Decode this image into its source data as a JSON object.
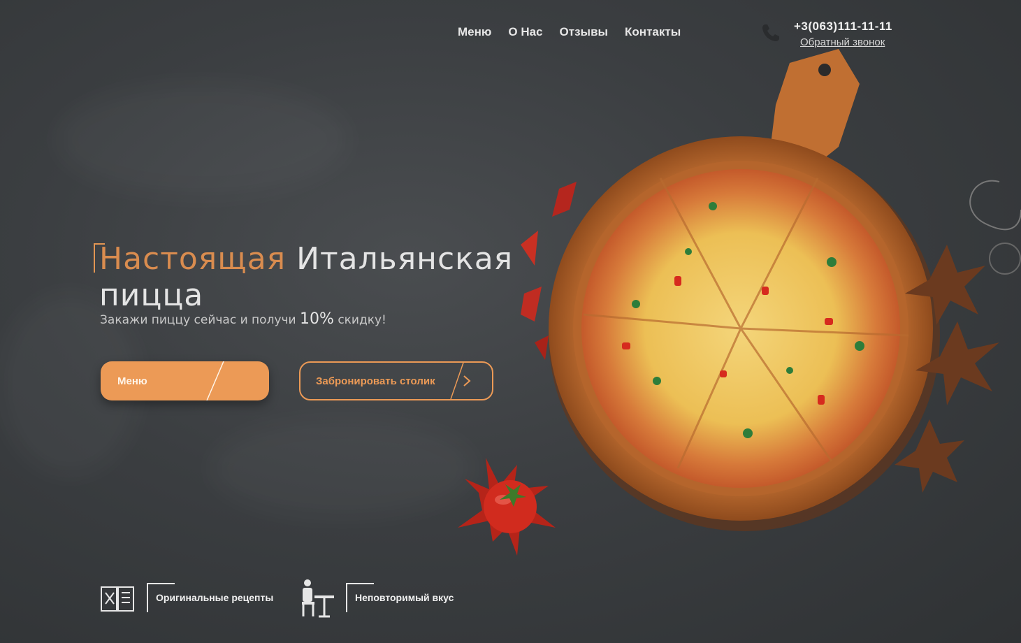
{
  "nav": {
    "items": [
      "Меню",
      "О Нас",
      "Отзывы",
      "Контакты"
    ]
  },
  "contact": {
    "phone": "+3(063)111-11-11",
    "callback_label": "Обратный звонок",
    "icon": "phone-icon"
  },
  "hero": {
    "title_accent": "Настоящая",
    "title_main": "Итальянская",
    "title_line2": "пицца",
    "subtitle_before": "Закажи пиццу сейчас и получи",
    "subtitle_percent": "10%",
    "subtitle_after": "скидку!"
  },
  "buttons": {
    "menu_label": "Меню",
    "book_label": "Забронировать столик"
  },
  "features": [
    {
      "label": "Оригинальные рецепты",
      "icon": "recipe-book-icon"
    },
    {
      "label": "Неповторимый вкус",
      "icon": "diner-at-table-icon"
    }
  ],
  "colors": {
    "accent": "#ec9a56",
    "background": "#3b3e41",
    "text": "#e6e6e6"
  }
}
